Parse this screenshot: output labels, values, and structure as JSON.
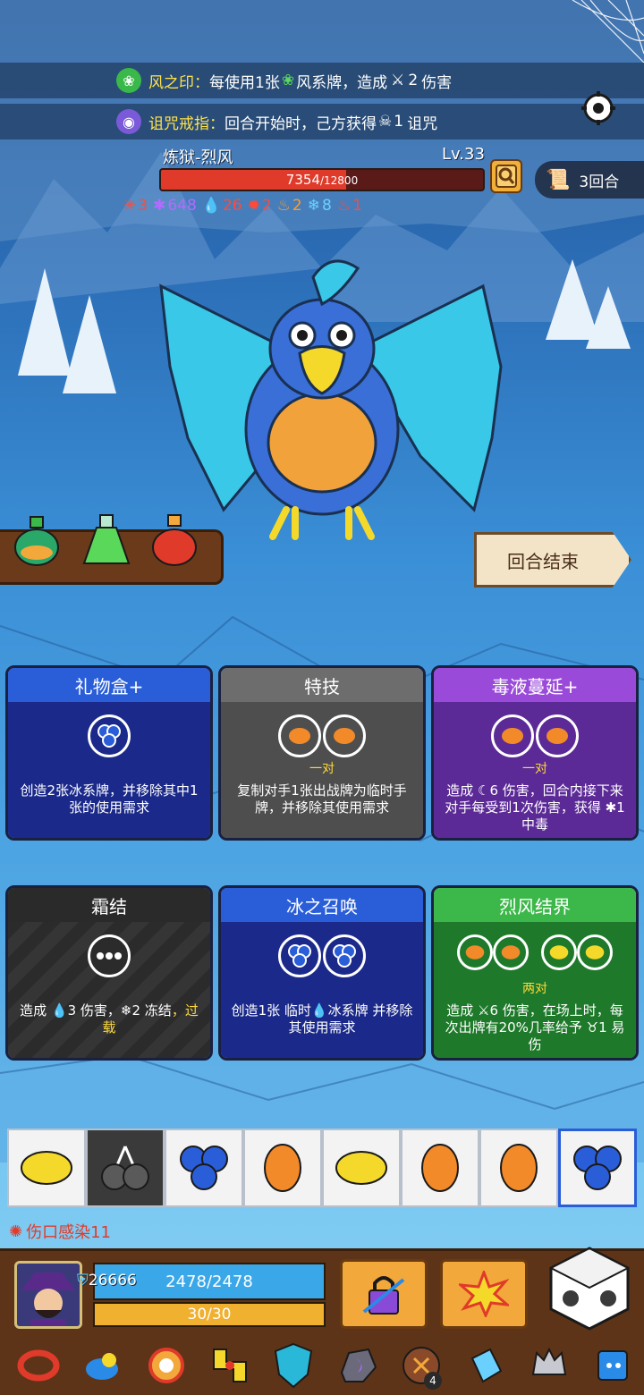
{
  "buffs": [
    {
      "title": "风之印：",
      "pre": "每使用1张",
      "mid": "风系牌，造成",
      "num": "2",
      "post": "伤害"
    },
    {
      "title": "诅咒戒指：",
      "pre": "回合开始时，己方获得",
      "num": "1",
      "post": "诅咒"
    }
  ],
  "boss": {
    "name": "炼狱-烈风",
    "level": "Lv.33",
    "hp_current": "7354",
    "hp_max": "/12800",
    "hp_fraction": 0.5745,
    "round": "3回合",
    "status": [
      {
        "icon": "claw-icon",
        "value": "3",
        "color": "#ff4a3a"
      },
      {
        "icon": "poison-splash-icon",
        "value": "648",
        "color": "#b56aff"
      },
      {
        "icon": "blood-drop-icon",
        "value": "26",
        "color": "#ff4a3a"
      },
      {
        "icon": "fracture-icon",
        "value": "2",
        "color": "#ff4a3a"
      },
      {
        "icon": "fire-icon",
        "value": "2",
        "color": "#ff9a2a"
      },
      {
        "icon": "snowflake-icon",
        "value": "8",
        "color": "#6ad0ff"
      },
      {
        "icon": "flame-icon",
        "value": "1",
        "color": "#ff4a3a"
      }
    ]
  },
  "end_turn_label": "回合结束",
  "cards": [
    {
      "title": "礼物盒+",
      "req": "",
      "desc": "创造2张冰系牌，并移除其中1张的使用需求"
    },
    {
      "title": "特技",
      "req": "一对",
      "desc": "复制对手1张出战牌为临时手牌，并移除其使用需求"
    },
    {
      "title": "毒液蔓延+",
      "req": "一对",
      "desc": "造成 ☾6 伤害，回合内接下来对手每受到1次伤害，获得 ✱1 中毒"
    },
    {
      "title": "霜结",
      "req": "",
      "desc_a": "造成 💧3 伤害，❄2 冻结",
      "desc_b": "，过载"
    },
    {
      "title": "冰之召唤",
      "req": "",
      "desc": "创造1张 临时💧冰系牌 并移除其使用需求"
    },
    {
      "title": "烈风结界",
      "req": "两对",
      "desc": "造成 ⚔6 伤害，在场上时，每次出牌有20%几率给予 ♉1 易伤"
    }
  ],
  "hand": [
    "lemon",
    "cherry",
    "blueberry",
    "mango",
    "lemon",
    "mango",
    "mango",
    "blueberry"
  ],
  "wound_label": "伤口感染11",
  "player": {
    "shield": "26666",
    "hp": "2478/2478",
    "energy": "30/30"
  },
  "relic_counter": "4",
  "colors": {
    "lemon": "#f5d92a",
    "mango": "#f28a2a",
    "blueberry": "#2a5ed8",
    "cherry": "#3a3a3a"
  }
}
